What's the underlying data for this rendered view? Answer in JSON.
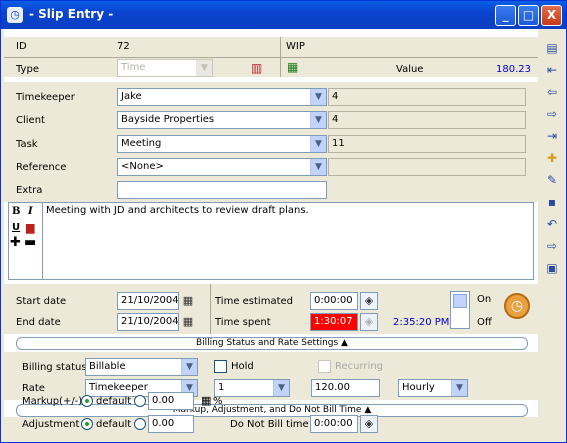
{
  "window": {
    "title": "- Slip Entry -",
    "minimize": "_",
    "maximize": "□",
    "close": "X"
  },
  "header": {
    "id_label": "ID",
    "id_value": "72",
    "wip_label": "WIP",
    "type_label": "Type",
    "type_value": "Time",
    "value_label": "Value",
    "value_value": "180.23"
  },
  "fields": {
    "timekeeper_label": "Timekeeper",
    "timekeeper_value": "Jake",
    "timekeeper_code": "4",
    "client_label": "Client",
    "client_value": "Bayside Properties",
    "client_code": "4",
    "task_label": "Task",
    "task_value": "Meeting",
    "task_code": "11",
    "reference_label": "Reference",
    "reference_value": "<None>",
    "extra_label": "Extra",
    "extra_value": "",
    "description": "Meeting with JD and architects to review draft plans.",
    "format_bold": "B",
    "format_italic": "I",
    "format_underline": "U"
  },
  "dates": {
    "start_label": "Start date",
    "start_value": "21/10/2004",
    "end_label": "End date",
    "end_value": "21/10/2004",
    "time_estimated_label": "Time estimated",
    "time_estimated_value": "0:00:00",
    "time_spent_label": "Time spent",
    "time_spent_value": "1:30:07",
    "clock_time": "2:35:20 PM",
    "on_label": "On",
    "off_label": "Off"
  },
  "billing": {
    "section_title": "Billing Status and Rate Settings ▲",
    "status_label": "Billing status",
    "status_value": "Billable",
    "hold_label": "Hold",
    "recurring_label": "Recurring",
    "rate_label": "Rate",
    "rate_source": "Timekeeper",
    "rate_level": "1",
    "rate_amount": "120.00",
    "rate_unit": "Hourly"
  },
  "markup": {
    "section_title": "Markup, Adjustment, and Do Not Bill Time ▲",
    "markup_label": "Markup(+/-)",
    "markup_default": "default",
    "markup_value": "0.00",
    "percent": "%",
    "adjustment_label": "Adjustment",
    "adjustment_default": "default",
    "adjustment_value": "0.00",
    "do_not_bill_label": "Do Not Bill time",
    "do_not_bill_value": "0:00:00"
  },
  "toolbar": {
    "icons": [
      "list-icon",
      "first-icon",
      "previous-icon",
      "next-icon",
      "last-icon",
      "add-icon",
      "find-icon",
      "save-icon",
      "undo-icon",
      "exit-icon",
      "report-icon"
    ]
  },
  "colors": {
    "title_bar": "#0a44cf",
    "value_text": "#0000cc",
    "time_spent_bg": "#ff0000",
    "clock_text": "#0000cc"
  }
}
